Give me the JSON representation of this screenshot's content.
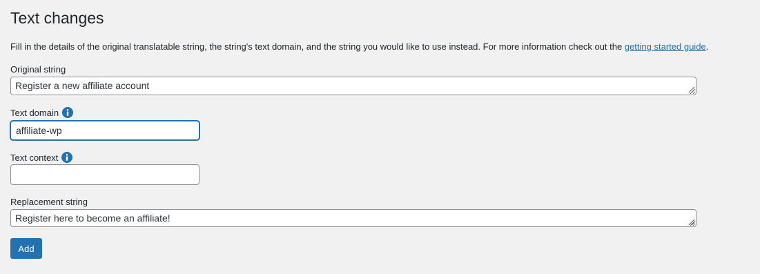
{
  "page": {
    "title": "Text changes",
    "description_text": "Fill in the details of the original translatable string, the string's text domain, and the string you would like to use instead. For more information check out the ",
    "description_link": "getting started guide",
    "description_end": "."
  },
  "form": {
    "original": {
      "label": "Original string",
      "value": "Register a new affiliate account"
    },
    "domain": {
      "label": "Text domain",
      "value": "affiliate-wp",
      "info_icon": "info-icon"
    },
    "context": {
      "label": "Text context",
      "value": "",
      "info_icon": "info-icon"
    },
    "replacement": {
      "label": "Replacement string",
      "value": "Register here to become an affiliate!"
    },
    "add_button": "Add"
  },
  "colors": {
    "accent": "#2271b1",
    "background": "#f1f1f1",
    "text": "#1d2327",
    "field_border": "#8c8f94"
  }
}
